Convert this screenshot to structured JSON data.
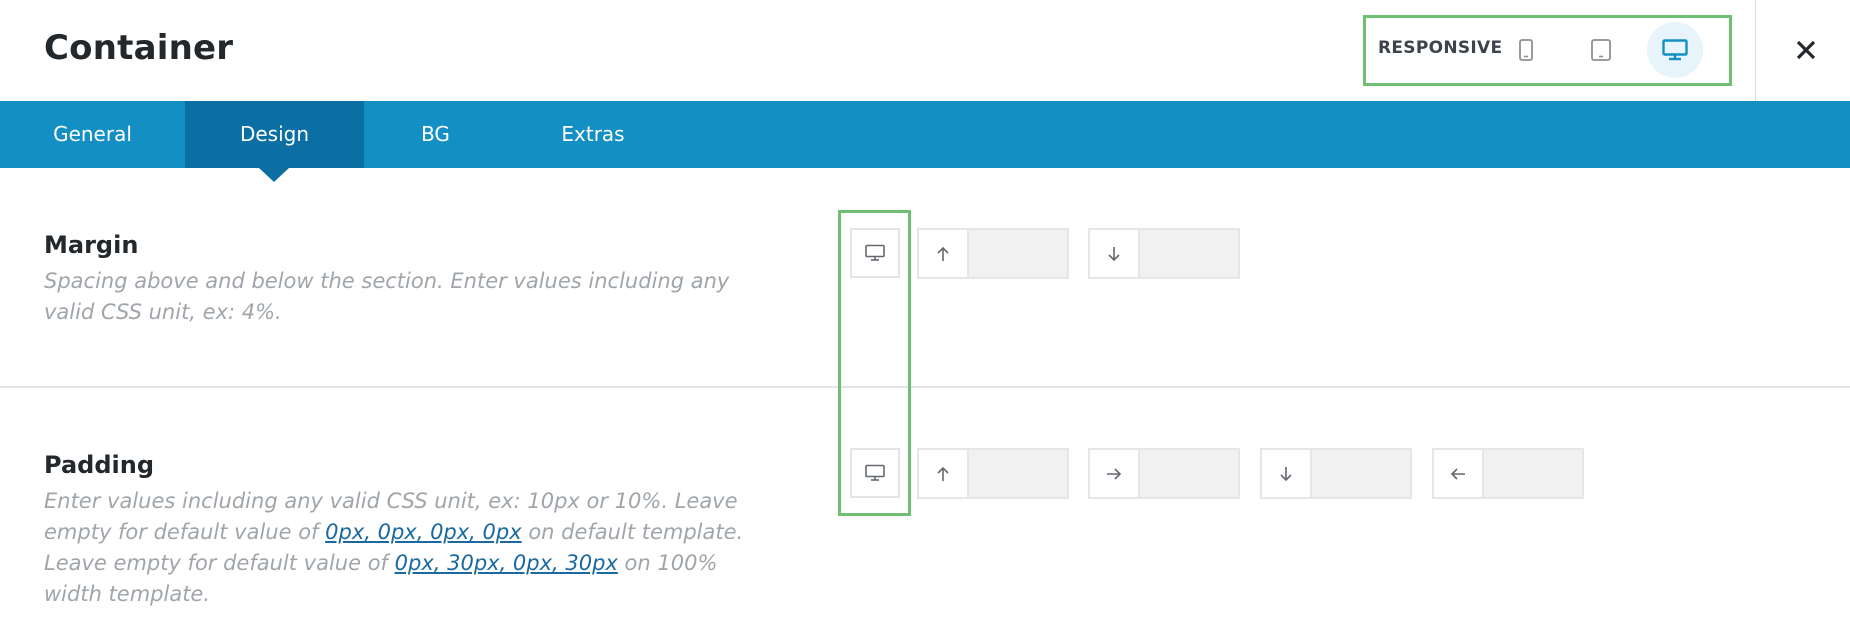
{
  "header": {
    "title": "Container",
    "responsive_label": "RESPONSIVE"
  },
  "devices": [
    {
      "name": "mobile",
      "icon": "mobile-icon",
      "active": false
    },
    {
      "name": "tablet",
      "icon": "tablet-icon",
      "active": false
    },
    {
      "name": "desktop",
      "icon": "desktop-icon",
      "active": true
    }
  ],
  "tabs": [
    {
      "label": "General",
      "active": false
    },
    {
      "label": "Design",
      "active": true
    },
    {
      "label": "BG",
      "active": false
    },
    {
      "label": "Extras",
      "active": false
    }
  ],
  "margin": {
    "title": "Margin",
    "description": "Spacing above and below the section. Enter values including any valid CSS unit, ex: 4%.",
    "fields": [
      {
        "icon": "arrow-up-icon",
        "value": ""
      },
      {
        "icon": "arrow-down-icon",
        "value": ""
      }
    ]
  },
  "padding": {
    "title": "Padding",
    "desc_part1": "Enter values including any valid CSS unit, ex: 10px or 10%. Leave empty for default value of ",
    "desc_link1": "0px, 0px, 0px, 0px",
    "desc_part2": " on default template. Leave empty for default value of ",
    "desc_link2": "0px, 30px, 0px, 30px",
    "desc_part3": " on 100% width template.",
    "fields": [
      {
        "icon": "arrow-up-icon",
        "value": ""
      },
      {
        "icon": "arrow-right-icon",
        "value": ""
      },
      {
        "icon": "arrow-down-icon",
        "value": ""
      },
      {
        "icon": "arrow-left-icon",
        "value": ""
      }
    ]
  },
  "colors": {
    "accent": "#138fc3",
    "tab_active": "#0c6fa3",
    "highlight": "#6fbf73",
    "link": "#1a6aa0"
  }
}
